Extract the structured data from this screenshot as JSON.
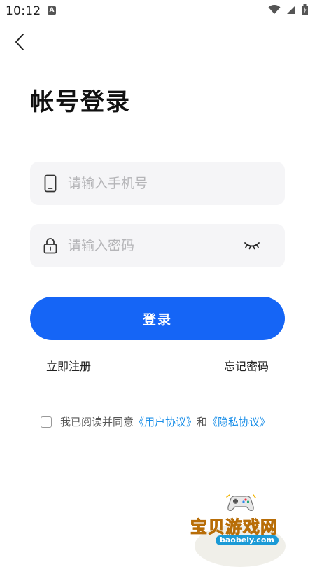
{
  "status_bar": {
    "time": "10:12",
    "notification_icon": "a-icon",
    "notification_letter": "A",
    "icons": [
      "wifi-icon",
      "cellular-icon",
      "battery-icon"
    ]
  },
  "header": {
    "back_icon": "chevron-left-icon"
  },
  "page": {
    "title": "帐号登录"
  },
  "form": {
    "phone": {
      "icon": "phone-icon",
      "value": "",
      "placeholder": "请输入手机号"
    },
    "password": {
      "icon": "lock-icon",
      "value": "",
      "placeholder": "请输入密码",
      "toggle_icon": "eye-closed-icon"
    },
    "login_label": "登录",
    "register_label": "立即注册",
    "forgot_label": "忘记密码"
  },
  "agreement": {
    "checked": false,
    "prefix": "我已阅读并同意",
    "user_agreement": "《用户协议》",
    "conjunction": "和",
    "privacy_policy": "《隐私协议》"
  },
  "watermark": {
    "name": "宝贝游戏网",
    "url": "baobeiy.com"
  },
  "colors": {
    "primary": "#1565f6",
    "link": "#1b8fe8",
    "field_bg": "#f5f5f7",
    "placeholder": "#b5b5b8"
  }
}
